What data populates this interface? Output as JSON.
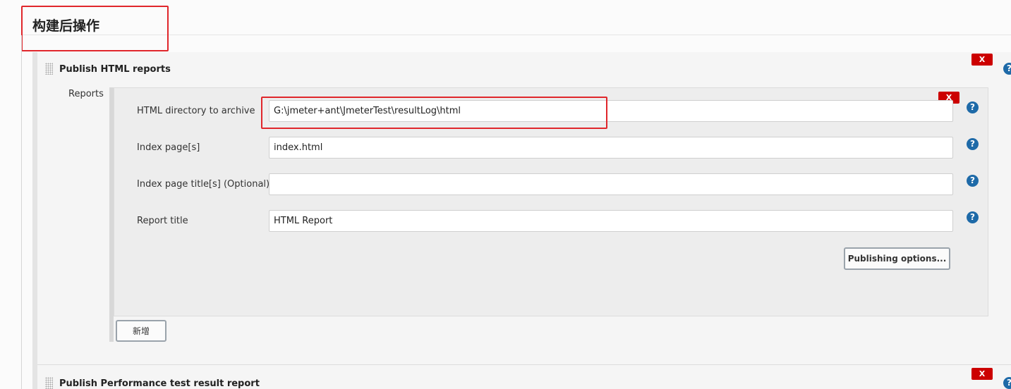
{
  "section": {
    "title": "构建后操作"
  },
  "html_reports": {
    "title": "Publish HTML reports",
    "delete_label": "X",
    "reports_label": "Reports",
    "entry": {
      "delete_label": "X",
      "fields": [
        {
          "label": "HTML directory to archive",
          "value": "G:\\jmeter+ant\\JmeterTest\\resultLog\\html"
        },
        {
          "label": "Index page[s]",
          "value": "index.html"
        },
        {
          "label": "Index page title[s] (Optional)",
          "value": ""
        },
        {
          "label": "Report title",
          "value": "HTML Report"
        }
      ],
      "publishing_options_label": "Publishing options..."
    },
    "add_label": "新增"
  },
  "performance_report": {
    "title": "Publish Performance test result report",
    "delete_label": "X"
  },
  "help_label": "?",
  "colors": {
    "highlight": "#e0262b",
    "delete": "#cc0000",
    "help": "#1e6aa8"
  }
}
